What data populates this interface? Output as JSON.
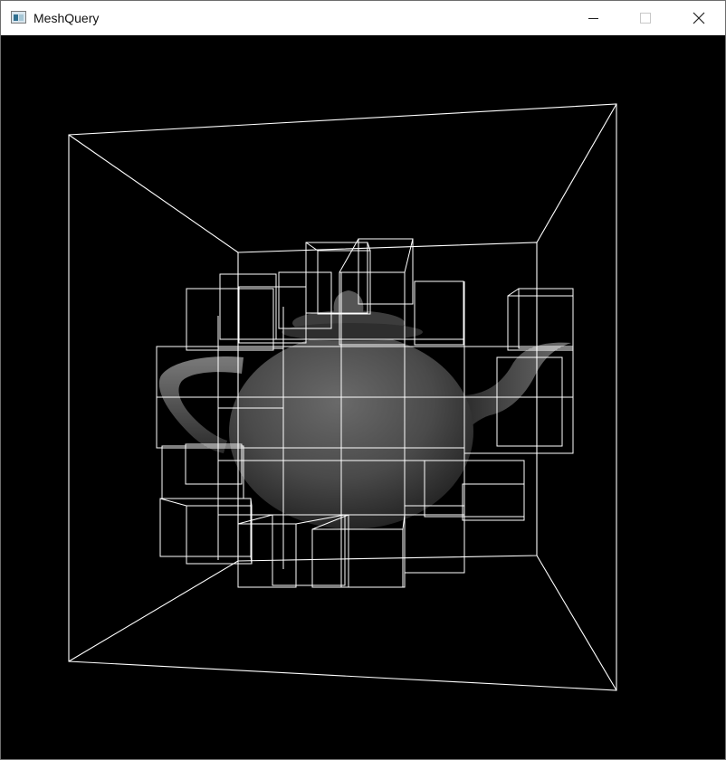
{
  "window": {
    "title": "MeshQuery",
    "icon": "application-window-icon",
    "controls": {
      "minimize": "minimize-icon",
      "maximize": "maximize-icon",
      "close": "close-icon"
    }
  },
  "viewport": {
    "background": "#000000",
    "wireframe_color": "#ffffff",
    "mesh_color": "#4a4a4a",
    "scene": "teapot-with-octree-wireframe"
  }
}
